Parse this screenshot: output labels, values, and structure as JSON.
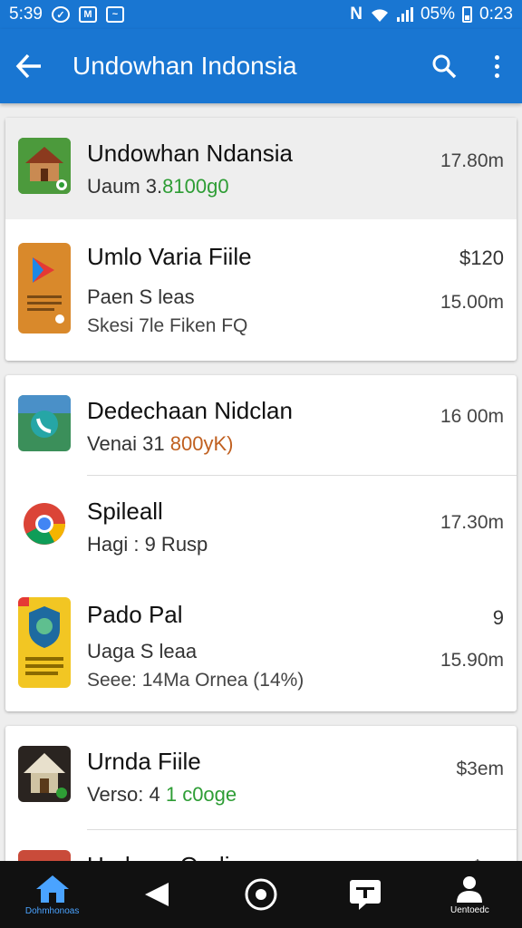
{
  "status_bar": {
    "time_left": "5:39",
    "battery": "05%",
    "time": "0:23"
  },
  "app_bar": {
    "title": "Undowhan Indonsia"
  },
  "cards": [
    {
      "items": [
        {
          "title": "Undowhan Ndansia",
          "line1_prefix": "Uaum 3.",
          "line1_accent": "8100g0",
          "right": "17.80m",
          "icon": "house-app-icon",
          "highlight": true
        },
        {
          "title": "Umlo Varia Fiile",
          "right_top": "$120",
          "line2": "Paen S leas",
          "right_bottom": "15.00m",
          "line3": "Skesi 7le Fiken FQ",
          "icon": "play-app-icon"
        }
      ]
    },
    {
      "items": [
        {
          "title": "Dedechaan Nidclan",
          "line1_prefix": "Venai 31",
          "line1_accent": "800yK)",
          "right": "16 00m",
          "icon": "phone-app-icon"
        },
        {
          "title": "Spileall",
          "line1_prefix": "Hagi : 9 Rusp",
          "right": "17.30m",
          "icon": "chrome-icon"
        },
        {
          "title": "Pado Pal",
          "right_top": "9",
          "line2": "Uaga S leaa",
          "right_bottom": "15.90m",
          "line3": "Seee: 14Ma Ornea (14%)",
          "icon": "shield-app-icon"
        }
      ]
    },
    {
      "items": [
        {
          "title": "Urnda Fiile",
          "line1_prefix": "Verso: 4",
          "line1_accent": "1 c0oge",
          "right": "$3em",
          "icon": "cabin-app-icon"
        },
        {
          "title": "Undawe Oudi...",
          "right": "$ ...",
          "icon": "partial-app-icon"
        }
      ]
    }
  ],
  "nav": [
    {
      "label": "Dohmhonoas",
      "icon": "home-icon",
      "active": true
    },
    {
      "label": "",
      "icon": "back-triangle-icon"
    },
    {
      "label": "",
      "icon": "home-circle-icon"
    },
    {
      "label": "",
      "icon": "recents-icon"
    },
    {
      "label": "Uentoedc",
      "icon": "profile-icon"
    }
  ]
}
